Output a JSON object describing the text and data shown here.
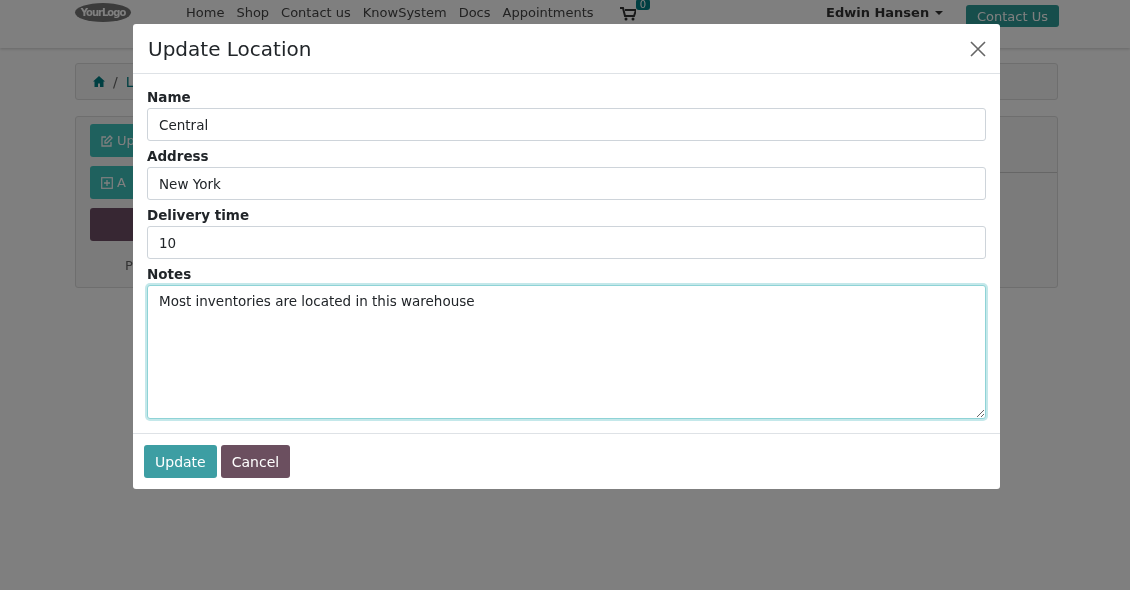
{
  "navbar": {
    "logo": "YourLogo",
    "menu": [
      "Home",
      "Shop",
      "Contact us",
      "KnowSystem",
      "Docs",
      "Appointments"
    ],
    "cart_count": "0",
    "user": "Edwin Hansen",
    "contact_button": "Contact Us"
  },
  "breadcrumb": {
    "separator": "/",
    "current": "L"
  },
  "actions": {
    "buttons": [
      {
        "kind": "update",
        "label": "Up"
      },
      {
        "kind": "add",
        "label": "A"
      },
      {
        "kind": "dark"
      }
    ],
    "footer_text": "P"
  },
  "modal": {
    "title": "Update Location",
    "fields": [
      {
        "kind": "input",
        "label": "Name",
        "value": "Central",
        "focused": false
      },
      {
        "kind": "input",
        "label": "Address",
        "value": "New York",
        "focused": false
      },
      {
        "kind": "input",
        "label": "Delivery time",
        "value": "10",
        "focused": false
      },
      {
        "kind": "textarea",
        "label": "Notes",
        "value": "Most inventories are located in this warehouse",
        "focused": true
      }
    ],
    "buttons": [
      {
        "kind": "primary",
        "label": "Update"
      },
      {
        "kind": "secondary",
        "label": "Cancel"
      }
    ]
  }
}
